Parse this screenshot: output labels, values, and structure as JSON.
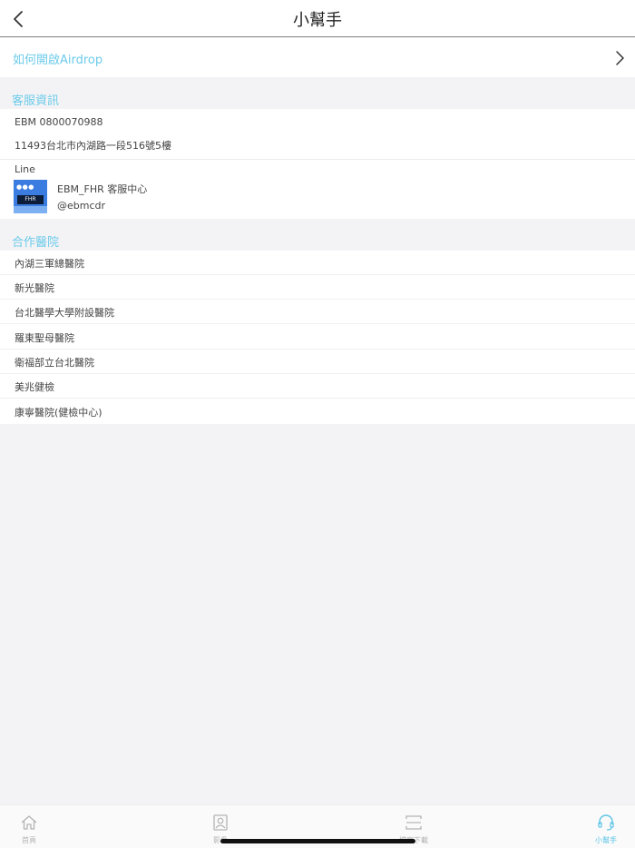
{
  "header": {
    "title": "小幫手",
    "back_icon": "chevron-left-icon"
  },
  "airdrop": {
    "label": "如何開啟Airdrop",
    "icon": "chevron-right-icon"
  },
  "customer_service": {
    "section_title": "客服資訊",
    "phone_line": "EBM 0800070988",
    "address": "11493台北市內湖路一段516號5樓",
    "line_label": "Line",
    "line_account_name": "EBM_FHR 客服中心",
    "line_id": "@ebmcdr",
    "logo_text": "FHR",
    "logo_dots": "●●●"
  },
  "hospitals": {
    "section_title": "合作醫院",
    "items": [
      "內湖三軍總醫院",
      "新光醫院",
      "台北醫學大學附設醫院",
      "羅東聖母醫院",
      "衛福部立台北醫院",
      "美兆健檢",
      "康寧醫院(健檢中心)"
    ]
  },
  "tabbar": {
    "items": [
      {
        "label": "首頁",
        "icon": "home-icon",
        "active": false
      },
      {
        "label": "影像",
        "icon": "portrait-icon",
        "active": false
      },
      {
        "label": "檔案下載",
        "icon": "scan-icon",
        "active": false
      },
      {
        "label": "小幫手",
        "icon": "headset-icon",
        "active": true
      }
    ]
  },
  "colors": {
    "accent": "#6ccbea",
    "background": "#f3f3f5",
    "logo_blue": "#3a7ce0"
  }
}
